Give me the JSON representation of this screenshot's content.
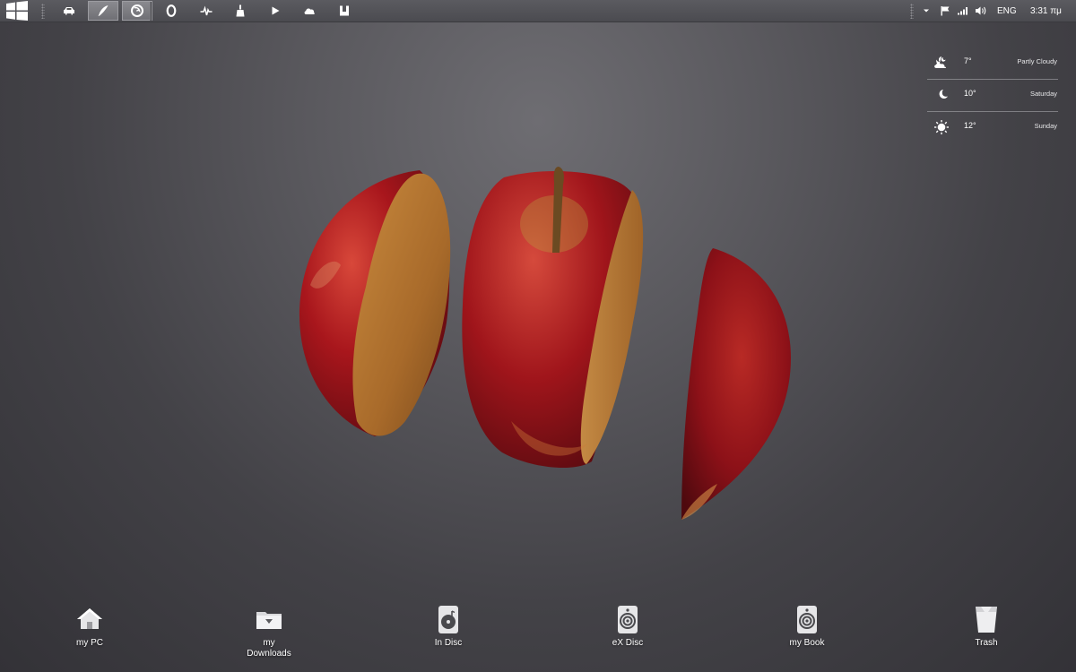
{
  "taskbar": {
    "start_icon": "windows-logo-icon",
    "pinned": [
      {
        "icon": "car-icon"
      },
      {
        "icon": "feather-pen-icon",
        "active": true
      },
      {
        "icon": "firefox-icon",
        "active": true
      },
      {
        "icon": "opera-icon"
      },
      {
        "icon": "pulse-icon"
      },
      {
        "icon": "broom-icon"
      },
      {
        "icon": "play-icon"
      },
      {
        "icon": "cloud-icon"
      },
      {
        "icon": "utorrent-icon"
      }
    ],
    "tray": {
      "language": "ENG",
      "clock": "3:31 πμ"
    }
  },
  "weather": [
    {
      "icon": "moon-cloud-icon",
      "temp": "7°",
      "desc": "Partly Cloudy"
    },
    {
      "icon": "moon-icon",
      "temp": "10°",
      "desc": "Saturday"
    },
    {
      "icon": "sun-icon",
      "temp": "12°",
      "desc": "Sunday"
    }
  ],
  "desktop_icons": [
    {
      "icon": "home-icon",
      "label": "my PC"
    },
    {
      "icon": "download-folder-icon",
      "label": "my\nDownloads"
    },
    {
      "icon": "music-disc-icon",
      "label": "In Disc"
    },
    {
      "icon": "speaker-icon",
      "label": "eX Disc"
    },
    {
      "icon": "speaker-icon",
      "label": "my Book"
    },
    {
      "icon": "trash-icon",
      "label": "Trash"
    }
  ],
  "colors": {
    "taskbar": "#4f4f54",
    "background": "#4a494e",
    "apple_red": "#a3141c",
    "apple_flesh": "#b3772f"
  }
}
